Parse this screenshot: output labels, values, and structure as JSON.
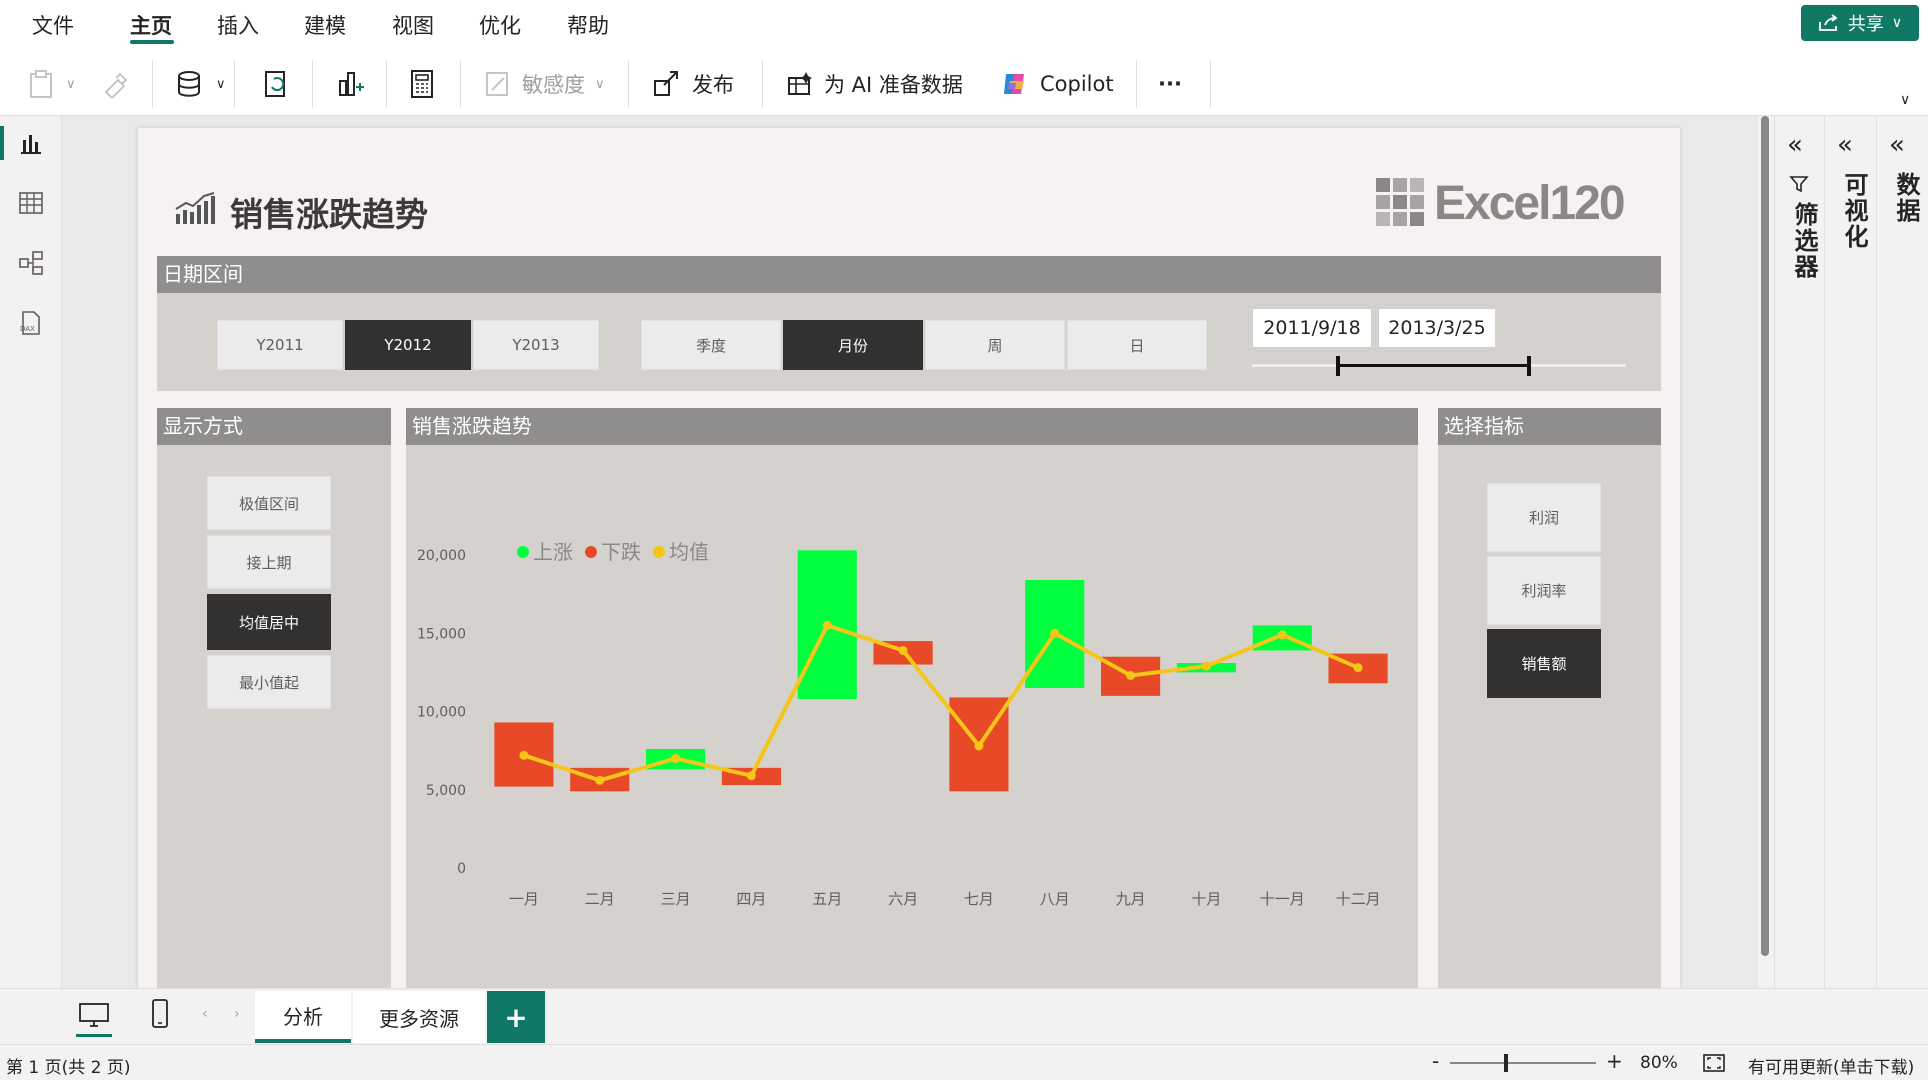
{
  "menu": {
    "tabs": [
      "文件",
      "主页",
      "插入",
      "建模",
      "视图",
      "优化",
      "帮助"
    ],
    "share_label": "共享"
  },
  "ribbon": {
    "sensitivity_label": "敏感度",
    "publish_label": "发布",
    "ai_label": "为 AI 准备数据",
    "copilot_label": "Copilot",
    "more_label": "···"
  },
  "report": {
    "title": "销售涨跌趋势",
    "logo_text": "Excel120",
    "date_panel": {
      "header": "日期区间",
      "years": [
        "Y2011",
        "Y2012",
        "Y2013"
      ],
      "selected_year": "Y2012",
      "granularity": [
        "季度",
        "月份",
        "周",
        "日"
      ],
      "selected_granularity": "月份",
      "date_start": "2011/9/18",
      "date_end": "2013/3/25",
      "range_start_fraction": 0.23,
      "range_end_fraction": 0.74
    },
    "display_panel": {
      "header": "显示方式",
      "options": [
        "极值区间",
        "接上期",
        "均值居中",
        "最小值起"
      ],
      "selected": "均值居中"
    },
    "chart_panel": {
      "header": "销售涨跌趋势"
    },
    "metric_panel": {
      "header": "选择指标",
      "options": [
        "利润",
        "利润率",
        "销售额"
      ],
      "selected": "销售额"
    }
  },
  "chart_data": {
    "type": "bar",
    "subtype": "floating-waterfall-with-line",
    "categories": [
      "一月",
      "二月",
      "三月",
      "四月",
      "五月",
      "六月",
      "七月",
      "八月",
      "九月",
      "十月",
      "十一月",
      "十二月"
    ],
    "series": [
      {
        "name": "上涨",
        "color": "#00ff3c",
        "ranges": [
          null,
          null,
          [
            6300,
            7600
          ],
          null,
          [
            10800,
            20300
          ],
          null,
          null,
          [
            11500,
            18400
          ],
          null,
          [
            12500,
            13100
          ],
          [
            13900,
            15500
          ],
          null
        ]
      },
      {
        "name": "下跌",
        "color": "#e84a27",
        "ranges": [
          [
            5200,
            9300
          ],
          [
            4900,
            6400
          ],
          null,
          [
            5300,
            6400
          ],
          null,
          [
            13000,
            14500
          ],
          [
            4900,
            10900
          ],
          null,
          [
            11000,
            13500
          ],
          null,
          null,
          [
            11800,
            13700
          ]
        ]
      },
      {
        "name": "均值",
        "color": "#f5c518",
        "type": "line",
        "values": [
          7200,
          5600,
          7000,
          5900,
          15500,
          13900,
          7800,
          15000,
          12300,
          12900,
          14900,
          12800
        ]
      }
    ],
    "ylim": [
      0,
      20000
    ],
    "yticks": [
      "0",
      "5,000",
      "10,000",
      "15,000",
      "20,000"
    ],
    "legend_position": "top-left"
  },
  "pages": {
    "tabs": [
      "分析",
      "更多资源"
    ],
    "active": "分析",
    "add_label": "+"
  },
  "panes": {
    "filter": "筛选器",
    "viz": "可视化",
    "data": "数据"
  },
  "status": {
    "page_info": "第 1 页(共 2 页)",
    "zoom": "80%",
    "update_text": "有可用更新(单击下载)"
  }
}
